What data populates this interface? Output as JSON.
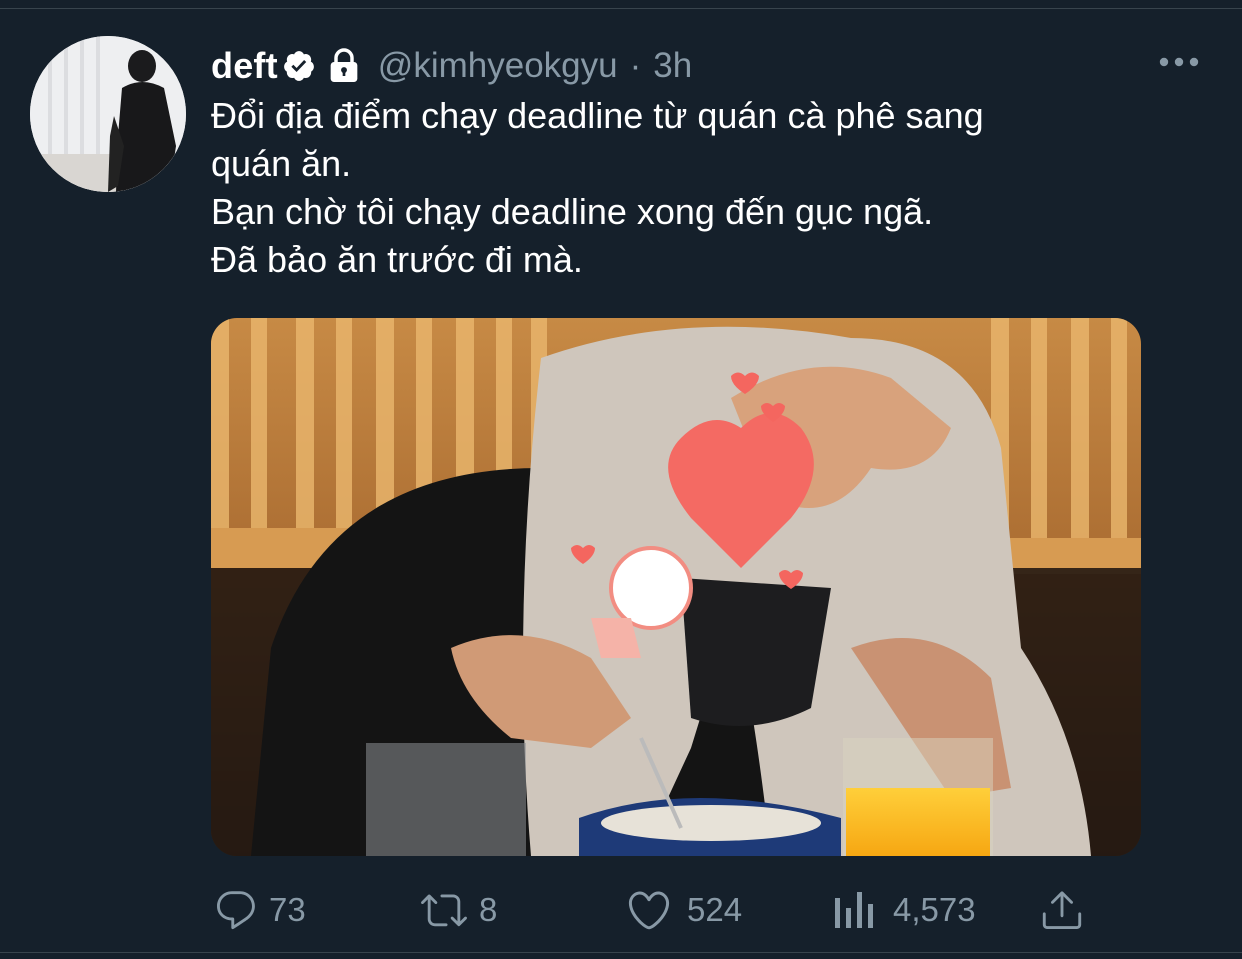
{
  "tweet": {
    "display_name": "deft",
    "handle": "@kimhyeokgyu",
    "separator": "·",
    "time": "3h",
    "text_lines": [
      "Đổi địa điểm chạy deadline từ quán cà phê sang",
      "quán ăn.",
      "Bạn chờ tôi chạy deadline xong đến gục ngã.",
      "Đã bảo ăn trước đi mà."
    ]
  },
  "actions": {
    "reply_count": "73",
    "retweet_count": "8",
    "like_count": "524",
    "views_count": "4,573"
  },
  "icons": {
    "verified": "verified-badge-icon",
    "lock": "lock-icon",
    "more": "more-icon",
    "reply": "reply-icon",
    "retweet": "retweet-icon",
    "like": "heart-icon",
    "views": "analytics-icon",
    "share": "share-icon"
  },
  "colors": {
    "background": "#15202b",
    "text": "#ffffff",
    "secondary": "#8899a6",
    "divider": "#38444d"
  }
}
